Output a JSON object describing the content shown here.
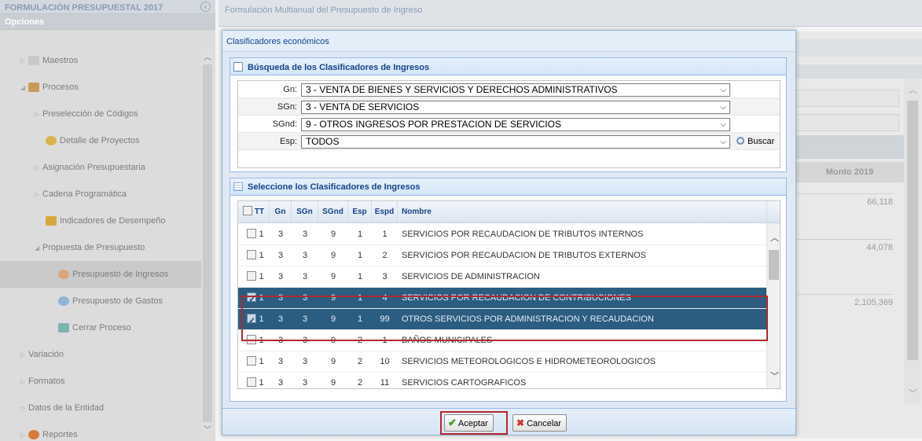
{
  "app": {
    "left_title": "FORMULACIÓN PRESUPUESTAL 2017",
    "left_subtitle": "Opciones",
    "main_title": "Formulación Multianual del Presupuesto de Ingreso"
  },
  "sidebar": {
    "items": [
      {
        "label": "Maestros"
      },
      {
        "label": "Procesos"
      },
      {
        "label": "Preselección de Códigos"
      },
      {
        "label": "Detalle de Proyectos"
      },
      {
        "label": "Asignación Presupuestaria"
      },
      {
        "label": "Cadena Programática"
      },
      {
        "label": "Indicadores de Desempeño"
      },
      {
        "label": "Propuesta de Presupuesto"
      },
      {
        "label": "Presupuesto de Ingresos"
      },
      {
        "label": "Presupuesto de Gastos"
      },
      {
        "label": "Cerrar Proceso"
      },
      {
        "label": "Variación"
      },
      {
        "label": "Formatos"
      },
      {
        "label": "Datos de la Entidad"
      },
      {
        "label": "Reportes"
      }
    ]
  },
  "background": {
    "monto_header": "Monto 2019",
    "amounts": [
      "66,118",
      "44,078",
      "2,105,369"
    ]
  },
  "dialog": {
    "title": "Clasificadores económicos",
    "search_section": {
      "title": "Búsqueda de los Clasificadores de Ingresos",
      "fields": [
        {
          "label": "Gn:",
          "value": "3 - VENTA DE BIENES Y SERVICIOS Y DERECHOS ADMINISTRATIVOS"
        },
        {
          "label": "SGn:",
          "value": "3 - VENTA DE SERVICIOS"
        },
        {
          "label": "SGnd:",
          "value": "9 - OTROS INGRESOS POR PRESTACION DE SERVICIOS"
        },
        {
          "label": "Esp:",
          "value": "TODOS"
        }
      ],
      "search_button": "Buscar"
    },
    "grid_section": {
      "title": "Seleccione los Clasificadores de Ingresos",
      "columns": [
        "TT",
        "Gn",
        "SGn",
        "SGnd",
        "Esp",
        "Espd",
        "Nombre"
      ],
      "rows": [
        {
          "tt": "1",
          "gn": "3",
          "sgn": "3",
          "sgnd": "9",
          "esp": "1",
          "espd": "1",
          "nombre": "SERVICIOS POR RECAUDACION DE TRIBUTOS INTERNOS",
          "checked": false
        },
        {
          "tt": "1",
          "gn": "3",
          "sgn": "3",
          "sgnd": "9",
          "esp": "1",
          "espd": "2",
          "nombre": "SERVICIOS POR RECAUDACION DE TRIBUTOS EXTERNOS",
          "checked": false
        },
        {
          "tt": "1",
          "gn": "3",
          "sgn": "3",
          "sgnd": "9",
          "esp": "1",
          "espd": "3",
          "nombre": "SERVICIOS DE ADMINISTRACION",
          "checked": false
        },
        {
          "tt": "1",
          "gn": "3",
          "sgn": "3",
          "sgnd": "9",
          "esp": "1",
          "espd": "4",
          "nombre": "SERVICIOS POR RECAUDACION DE CONTRIBUCIONES",
          "checked": true
        },
        {
          "tt": "1",
          "gn": "3",
          "sgn": "3",
          "sgnd": "9",
          "esp": "1",
          "espd": "99",
          "nombre": "OTROS SERVICIOS POR ADMINISTRACION Y RECAUDACION",
          "checked": true
        },
        {
          "tt": "1",
          "gn": "3",
          "sgn": "3",
          "sgnd": "9",
          "esp": "2",
          "espd": "1",
          "nombre": "BAÑOS MUNICIPALES",
          "checked": false
        },
        {
          "tt": "1",
          "gn": "3",
          "sgn": "3",
          "sgnd": "9",
          "esp": "2",
          "espd": "10",
          "nombre": "SERVICIOS METEOROLOGICOS E HIDROMETEOROLOGICOS",
          "checked": false
        },
        {
          "tt": "1",
          "gn": "3",
          "sgn": "3",
          "sgnd": "9",
          "esp": "2",
          "espd": "11",
          "nombre": "SERVICIOS CARTOGRAFICOS",
          "checked": false
        }
      ]
    },
    "buttons": {
      "accept": "Aceptar",
      "cancel": "Cancelar"
    }
  },
  "colors": {
    "selected_row": "#2b5d80",
    "highlight_box": "#b3282d",
    "header_text": "#15428b"
  }
}
